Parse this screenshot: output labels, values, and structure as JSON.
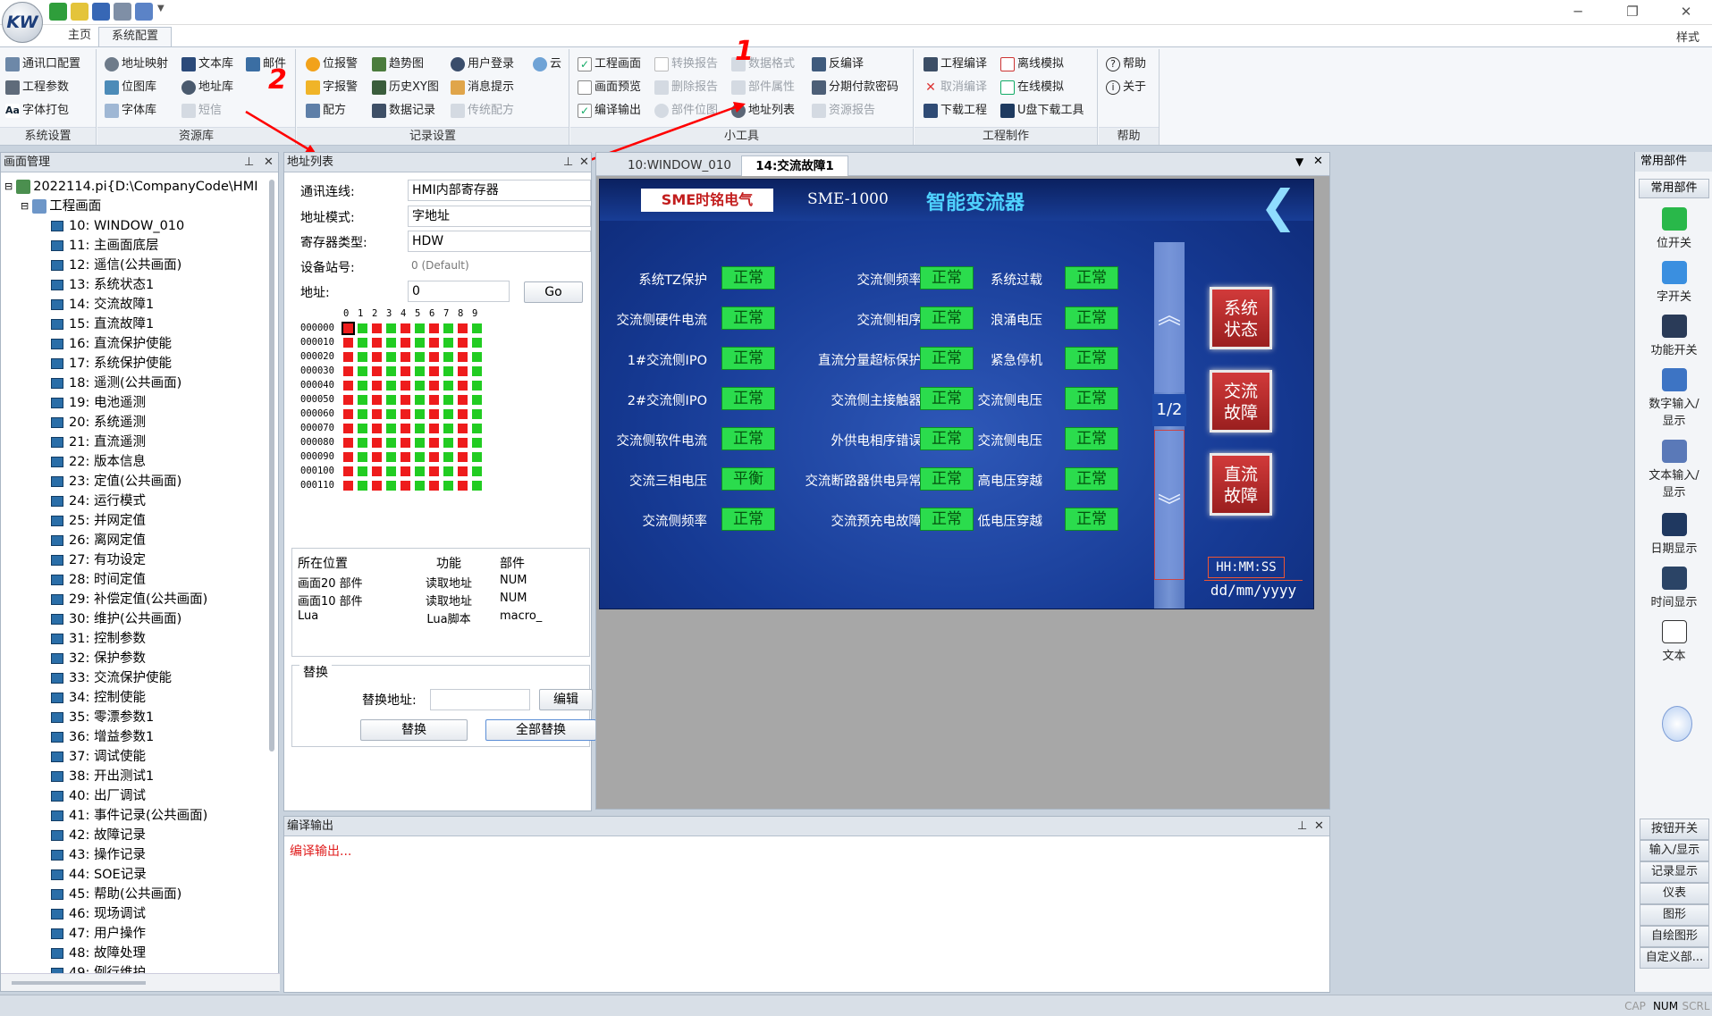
{
  "titlebar": {
    "tabs": [
      "主页",
      "系统配置"
    ],
    "style_label": "样式"
  },
  "ribbon": {
    "groups": [
      {
        "label": "系统设置",
        "items": [
          "通讯口配置",
          "工程参数",
          "字体打包"
        ]
      },
      {
        "label": "资源库",
        "items": [
          "地址映射",
          "文本库",
          "邮件",
          "位图库",
          "地址库",
          "字体库",
          "短信"
        ]
      },
      {
        "label": "记录设置",
        "items": [
          "位报警",
          "趋势图",
          "用户登录",
          "云",
          "字报警",
          "历史XY图",
          "消息提示",
          "配方",
          "数据记录",
          "传统配方"
        ]
      },
      {
        "label": "小工具",
        "items": [
          "工程画面",
          "转换报告",
          "数据格式",
          "反编译",
          "画面预览",
          "删除报告",
          "部件属性",
          "分期付款密码",
          "编译输出",
          "部件位图",
          "地址列表",
          "资源报告"
        ]
      },
      {
        "label": "工程制作",
        "items": [
          "工程编译",
          "离线模拟",
          "取消编译",
          "在线模拟",
          "下载工程",
          "U盘下载工具"
        ]
      },
      {
        "label": "帮助",
        "items": [
          "帮助",
          "关于"
        ]
      }
    ],
    "annotations": [
      "1",
      "2"
    ]
  },
  "screen_panel": {
    "title": "画面管理",
    "root": "2022114.pi{D:\\CompanyCode\\HMI",
    "folder": "工程画面",
    "items": [
      "10: WINDOW_010",
      "11: 主画面底层",
      "12: 遥信(公共画面)",
      "13: 系统状态1",
      "14: 交流故障1",
      "15: 直流故障1",
      "16: 直流保护使能",
      "17: 系统保护使能",
      "18: 遥测(公共画面)",
      "19: 电池遥测",
      "20: 系统遥测",
      "21: 直流遥测",
      "22: 版本信息",
      "23: 定值(公共画面)",
      "24: 运行模式",
      "25: 并网定值",
      "26: 离网定值",
      "27: 有功设定",
      "28: 时间定值",
      "29: 补偿定值(公共画面)",
      "30: 维护(公共画面)",
      "31: 控制参数",
      "32: 保护参数",
      "33: 交流保护使能",
      "34: 控制使能",
      "35: 零漂参数1",
      "36: 增益参数1",
      "37: 调试使能",
      "38: 开出测试1",
      "40: 出厂调试",
      "41: 事件记录(公共画面)",
      "42: 故障记录",
      "43: 操作记录",
      "44: SOE记录",
      "45: 帮助(公共画面)",
      "46: 现场调试",
      "47: 用户操作",
      "48: 故障处理",
      "49: 例行维护"
    ]
  },
  "address_panel": {
    "title": "地址列表",
    "fields": [
      {
        "label": "通讯连线:",
        "value": "HMI内部寄存器"
      },
      {
        "label": "地址模式:",
        "value": "字地址"
      },
      {
        "label": "寄存器类型:",
        "value": "HDW"
      },
      {
        "label": "设备站号:",
        "value": "0 (Default)"
      },
      {
        "label": "地址:",
        "value": "0"
      }
    ],
    "go_label": "Go",
    "bit_columns": [
      "0",
      "1",
      "2",
      "3",
      "4",
      "5",
      "6",
      "7",
      "8",
      "9"
    ],
    "bit_rows": [
      "000000",
      "000010",
      "000020",
      "000030",
      "000040",
      "000050",
      "000060",
      "000070",
      "000080",
      "000090",
      "000100",
      "000110"
    ],
    "bit_used_columns": [
      1,
      3,
      5,
      7,
      9
    ],
    "colors": {
      "used": "#22cc22",
      "unused": "#ee1c1c"
    },
    "table": {
      "headers": [
        "所在位置",
        "功能",
        "部件"
      ],
      "rows": [
        [
          "画面20 部件",
          "读取地址",
          "NUM"
        ],
        [
          "画面10 部件",
          "读取地址",
          "NUM"
        ],
        [
          "Lua",
          "Lua脚本",
          "macro_"
        ]
      ]
    },
    "replace": {
      "title": "替换",
      "label": "替换地址:",
      "edit": "编辑",
      "replace": "替换",
      "replace_all": "全部替换"
    }
  },
  "doc_tabs": [
    "10:WINDOW_010",
    "14:交流故障1"
  ],
  "hmi": {
    "logo": "SME时铭电气",
    "model": "SME-1000",
    "product": "智能变流器",
    "status_text": "正常",
    "rows": [
      [
        "系统TZ保护",
        "交流侧频率",
        "系统过载"
      ],
      [
        "交流侧硬件电流",
        "交流侧相序",
        "浪涌电压"
      ],
      [
        "1#交流侧IPO",
        "直流分量超标保护",
        "紧急停机"
      ],
      [
        "2#交流侧IPO",
        "交流侧主接触器",
        "交流侧电压"
      ],
      [
        "交流侧软件电流",
        "外供电相序错误",
        "交流侧电压"
      ],
      [
        "交流三相电压",
        "交流断路器供电异常",
        "高电压穿越"
      ],
      [
        "交流侧频率",
        "交流预充电故障",
        "低电压穿越"
      ]
    ],
    "special_status": "平衡",
    "page": "1/2",
    "buttons": [
      "系统\n状态",
      "交流\n故障",
      "直流\n故障"
    ],
    "time": "HH:MM:SS",
    "date": "dd/mm/yyyy"
  },
  "compile_panel": {
    "title": "编译输出",
    "text": "编译输出..."
  },
  "parts_panel": {
    "title": "常用部件",
    "subtitle": "常用部件",
    "items": [
      "位开关",
      "字开关",
      "功能开关",
      "数字输入/\n显示",
      "文本输入/\n显示",
      "日期显示",
      "时间显示",
      "文本"
    ],
    "categories": [
      "按钮开关",
      "输入/显示",
      "记录显示",
      "仪表",
      "图形",
      "自绘图形",
      "自定义部..."
    ]
  },
  "status": [
    "CAP",
    "NUM",
    "SCRL"
  ]
}
